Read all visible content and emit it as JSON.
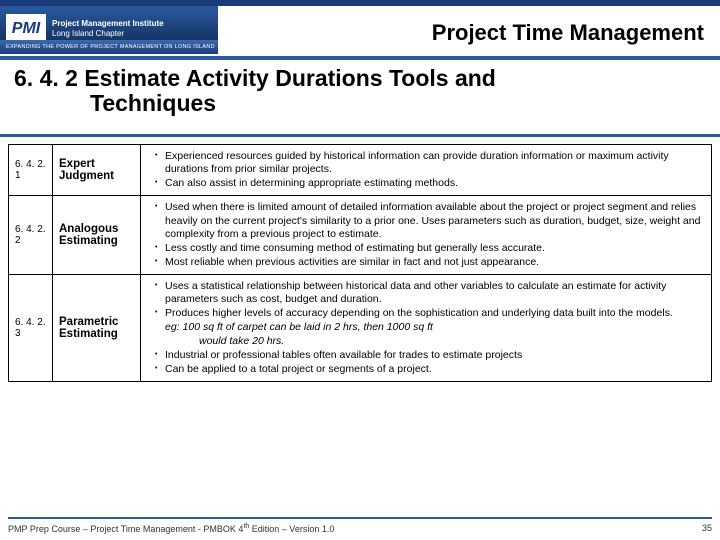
{
  "header": {
    "logo_mark": "PMI",
    "logo_line1": "Project Management Institute",
    "logo_line2": "Long Island Chapter",
    "logo_sub": "EXPANDING THE POWER OF PROJECT MANAGEMENT ON LONG ISLAND",
    "page_title": "Project Time Management"
  },
  "section": {
    "number": "6. 4. 2",
    "title_line1": "Estimate Activity Durations Tools and",
    "title_line2": "Techniques"
  },
  "rows": [
    {
      "num": "6. 4. 2. 1",
      "name": "Expert Judgment",
      "bullets": [
        "Experienced resources guided by  historical information can provide duration information or maximum activity durations from prior similar projects.",
        "Can also assist in determining appropriate estimating methods."
      ]
    },
    {
      "num": "6. 4. 2. 2",
      "name": "Analogous Estimating",
      "bullets": [
        "Used when there is limited amount of detailed information available about the project or project segment and relies heavily on the current project's similarity to a prior one. Uses parameters such as duration, budget, size, weight and complexity from a previous project to estimate.",
        "Less costly and time consuming method of estimating but generally less accurate.",
        "Most reliable when previous activities are similar in fact and not just appearance."
      ]
    },
    {
      "num": "6. 4. 2. 3",
      "name": "Parametric Estimating",
      "bullets": [
        "Uses a statistical relationship between historical data and other variables to calculate an estimate for activity parameters such as cost, budget and duration.",
        "Produces higher levels of accuracy depending on the sophistication and underlying data built into the models.",
        "Industrial or professional tables often available for trades to estimate projects",
        "Can be applied to a total project or segments of a project."
      ],
      "eg1": "eg:  100 sq ft of carpet can be laid in 2 hrs, then 1000 sq ft",
      "eg2": "would take 20 hrs."
    }
  ],
  "footer": {
    "left1": "PMP Prep Course – Project Time Management - PMBOK 4",
    "left_sup": "th",
    "left2": " Edition – Version 1.0",
    "page": "35"
  }
}
